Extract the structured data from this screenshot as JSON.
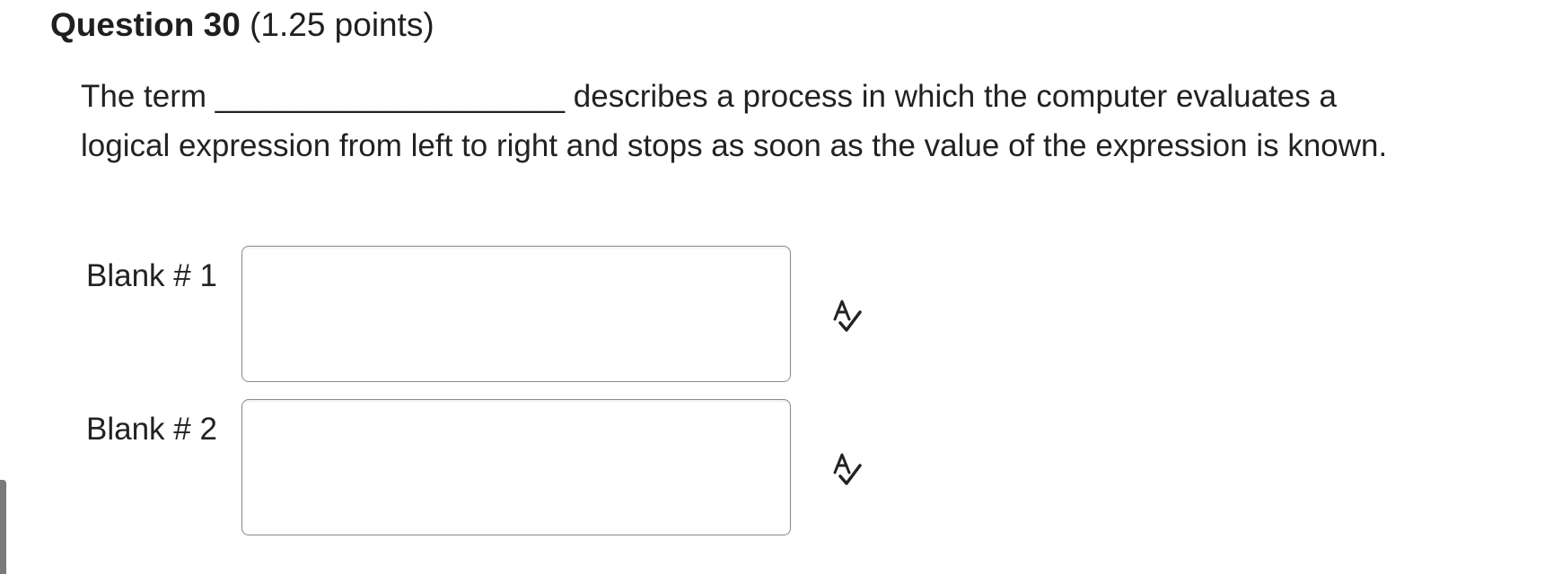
{
  "question": {
    "title": "Question 30",
    "points": "(1.25 points)",
    "text": "The term ____________________ describes a process in which the computer evaluates a logical expression from left to right and stops as soon as the value of the expression is known."
  },
  "blanks": [
    {
      "label": "Blank # 1",
      "value": "",
      "icon": "spell-check-icon"
    },
    {
      "label": "Blank # 2",
      "value": "",
      "icon": "spell-check-icon"
    }
  ]
}
